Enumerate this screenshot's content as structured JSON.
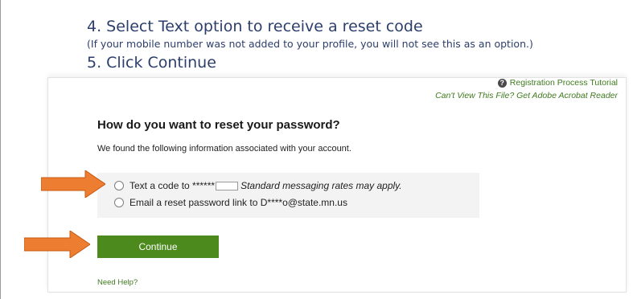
{
  "instructions": {
    "step4": "4. Select Text option to receive a reset code",
    "note": "(If your mobile number was not added to your profile, you will not see this as an option.)",
    "step5": "5.  Click Continue"
  },
  "header_links": {
    "tutorial": "Registration Process Tutorial",
    "acrobat": "Can't View This File? Get Adobe Acrobat Reader"
  },
  "form": {
    "title": "How do you want to reset your password?",
    "found_text": "We found the following information associated with your account.",
    "options": [
      {
        "label": "Text a code to ******",
        "note": "Standard messaging rates may apply."
      },
      {
        "label": "Email a reset password link to D****o@state.mn.us"
      }
    ],
    "continue_label": "Continue",
    "help_link": "Need Help?"
  },
  "colors": {
    "accent_green": "#4c8a1e",
    "link_green": "#3f7a1f",
    "arrow_orange": "#ed7d31",
    "instruction_blue": "#2c3e6b"
  },
  "icons": {
    "help": "question-circle-icon",
    "arrow": "right-arrow-icon"
  }
}
